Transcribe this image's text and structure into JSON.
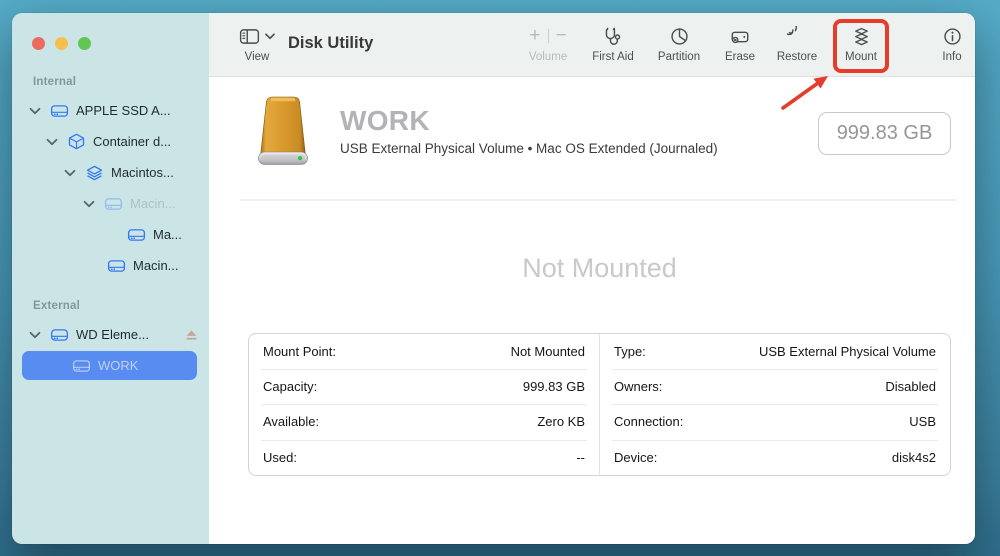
{
  "window": {
    "title": "Disk Utility"
  },
  "titlebar": {
    "view": {
      "label": "View"
    },
    "buttons": [
      {
        "id": "volume",
        "label": "Volume",
        "icon": "plus-minus-icon",
        "disabled": true,
        "plus": "+",
        "minus": "−"
      },
      {
        "id": "first-aid",
        "label": "First Aid",
        "icon": "stethoscope-icon"
      },
      {
        "id": "partition",
        "label": "Partition",
        "icon": "pie-chart-icon"
      },
      {
        "id": "erase",
        "label": "Erase",
        "icon": "erase-drive-icon"
      },
      {
        "id": "restore",
        "label": "Restore",
        "icon": "restore-arrow-icon"
      },
      {
        "id": "mount",
        "label": "Mount",
        "icon": "mount-stack-icon",
        "highlighted": true
      },
      {
        "id": "info",
        "label": "Info",
        "icon": "info-circle-icon"
      }
    ]
  },
  "sidebar": {
    "sections": [
      {
        "header": "Internal",
        "items": [
          {
            "label": "APPLE SSD A...",
            "icon": "internal-disk-icon",
            "expanded": true
          },
          {
            "label": "Container d...",
            "icon": "container-icon",
            "expanded": true
          },
          {
            "label": "Macintos...",
            "icon": "apfs-volume-icon",
            "expanded": true
          },
          {
            "label": "Macin...",
            "icon": "disk-icon",
            "expanded": true,
            "dimmed": true
          },
          {
            "label": "Ma...",
            "icon": "disk-icon"
          },
          {
            "label": "Macin...",
            "icon": "disk-icon"
          }
        ]
      },
      {
        "header": "External",
        "items": [
          {
            "label": "WD Eleme...",
            "icon": "external-disk-icon",
            "expanded": true,
            "ejectable": true
          },
          {
            "label": "WORK",
            "icon": "disk-icon",
            "selected": true
          }
        ]
      }
    ]
  },
  "main": {
    "volume_title": "WORK",
    "volume_subtitle": "USB External Physical Volume • Mac OS Extended (Journaled)",
    "capacity_badge": "999.83 GB",
    "status": "Not Mounted",
    "details": {
      "left": [
        {
          "label": "Mount Point:",
          "value": "Not Mounted"
        },
        {
          "label": "Capacity:",
          "value": "999.83 GB"
        },
        {
          "label": "Available:",
          "value": "Zero KB"
        },
        {
          "label": "Used:",
          "value": "--"
        }
      ],
      "right": [
        {
          "label": "Type:",
          "value": "USB External Physical Volume"
        },
        {
          "label": "Owners:",
          "value": "Disabled"
        },
        {
          "label": "Connection:",
          "value": "USB"
        },
        {
          "label": "Device:",
          "value": "disk4s2"
        }
      ]
    }
  },
  "annotations": {
    "target": "Mount"
  },
  "colors": {
    "selection_blue": "#588cf0",
    "sidebar_icon_blue": "#3478f6",
    "annotation_red": "#e73b2b",
    "drive_gold": "#d9952c",
    "led_green": "#30c24d"
  }
}
